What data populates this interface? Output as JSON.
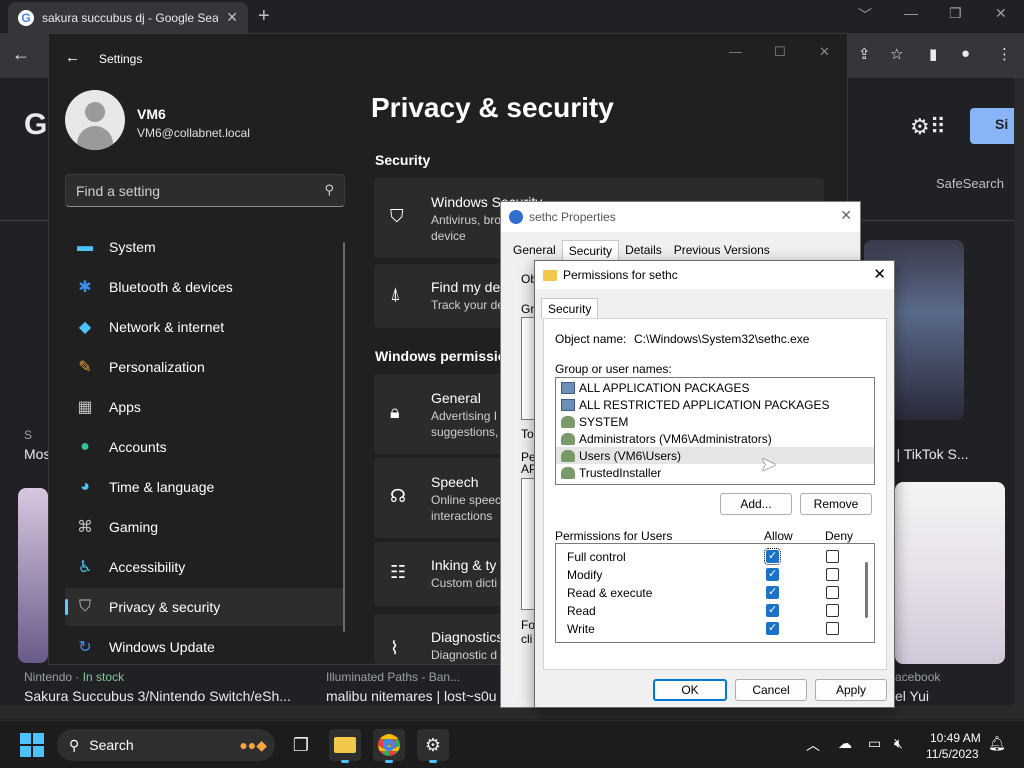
{
  "browser": {
    "tab_title": "sakura succubus dj - Google Sea",
    "tab_close": "✕",
    "new_tab": "+",
    "win_min": "﹀",
    "win_minimize": "—",
    "win_restore": "❐",
    "win_close": "✕",
    "safesearch": "SafeSearch",
    "signin_label": "Si",
    "g_logo_text": "G",
    "results": {
      "left_small": "S",
      "left_title": "Mos",
      "right_title": "ous | TikTok S...",
      "bottom1_source": "Nintendo",
      "bottom1_instock": "In stock",
      "bottom1_title": "Sakura Succubus 3/Nintendo Switch/eSh...",
      "bottom2_source": "Illuminated Paths - Ban...",
      "bottom2_title": "malibu nitemares | lost~s0u",
      "bottom3_source": "acebook",
      "bottom3_title": "el Yui"
    }
  },
  "settings": {
    "title": "Settings",
    "user_name": "VM6",
    "user_email": "VM6@collabnet.local",
    "search_placeholder": "Find a setting",
    "page_title": "Privacy & security",
    "nav": [
      {
        "label": "System",
        "icon": "system-icon"
      },
      {
        "label": "Bluetooth & devices",
        "icon": "bluetooth-icon"
      },
      {
        "label": "Network & internet",
        "icon": "network-icon"
      },
      {
        "label": "Personalization",
        "icon": "brush-icon"
      },
      {
        "label": "Apps",
        "icon": "apps-icon"
      },
      {
        "label": "Accounts",
        "icon": "accounts-icon"
      },
      {
        "label": "Time & language",
        "icon": "globe-icon"
      },
      {
        "label": "Gaming",
        "icon": "gamepad-icon"
      },
      {
        "label": "Accessibility",
        "icon": "accessibility-icon"
      },
      {
        "label": "Privacy & security",
        "icon": "shield-icon",
        "active": true
      },
      {
        "label": "Windows Update",
        "icon": "update-icon"
      }
    ],
    "sections": {
      "security": "Security",
      "windows_permissions": "Windows permissio"
    },
    "cards": [
      {
        "title": "Windows Security",
        "sub": "Antivirus, bro\ndevice"
      },
      {
        "title": "Find my de",
        "sub": "Track your de"
      },
      {
        "title": "General",
        "sub": "Advertising I\nsuggestions,"
      },
      {
        "title": "Speech",
        "sub": "Online speec\ninteractions"
      },
      {
        "title": "Inking & ty",
        "sub": "Custom dicti"
      },
      {
        "title": "Diagnostics",
        "sub": "Diagnostic d"
      }
    ]
  },
  "properties": {
    "title": "sethc Properties",
    "tabs": [
      "General",
      "Security",
      "Details",
      "Previous Versions"
    ],
    "active_tab": "Security",
    "stub_ob": "Ob",
    "stub_gr": "Gr",
    "stub_to": "To",
    "stub_pe": "Pe",
    "stub_ap": "AP",
    "stub_fo": "Fo",
    "stub_cli": "cli"
  },
  "permissions": {
    "title": "Permissions for sethc",
    "tab": "Security",
    "object_name_label": "Object name:",
    "object_name_value": "C:\\Windows\\System32\\sethc.exe",
    "group_label": "Group or user names:",
    "users": [
      {
        "name": "ALL APPLICATION PACKAGES",
        "type": "pkg"
      },
      {
        "name": "ALL RESTRICTED APPLICATION PACKAGES",
        "type": "pkg"
      },
      {
        "name": "SYSTEM",
        "type": "grp"
      },
      {
        "name": "Administrators (VM6\\Administrators)",
        "type": "grp"
      },
      {
        "name": "Users (VM6\\Users)",
        "type": "grp",
        "selected": true
      },
      {
        "name": "TrustedInstaller",
        "type": "grp"
      }
    ],
    "add_button": "Add...",
    "remove_button": "Remove",
    "perms_label": "Permissions for Users",
    "allow_label": "Allow",
    "deny_label": "Deny",
    "perms": [
      {
        "name": "Full control",
        "allow": true,
        "deny": false
      },
      {
        "name": "Modify",
        "allow": true,
        "deny": false
      },
      {
        "name": "Read & execute",
        "allow": true,
        "deny": false
      },
      {
        "name": "Read",
        "allow": true,
        "deny": false
      },
      {
        "name": "Write",
        "allow": true,
        "deny": false
      }
    ],
    "ok_button": "OK",
    "cancel_button": "Cancel",
    "apply_button": "Apply"
  },
  "taskbar": {
    "search_label": "Search",
    "time": "10:49 AM",
    "date": "11/5/2023"
  }
}
